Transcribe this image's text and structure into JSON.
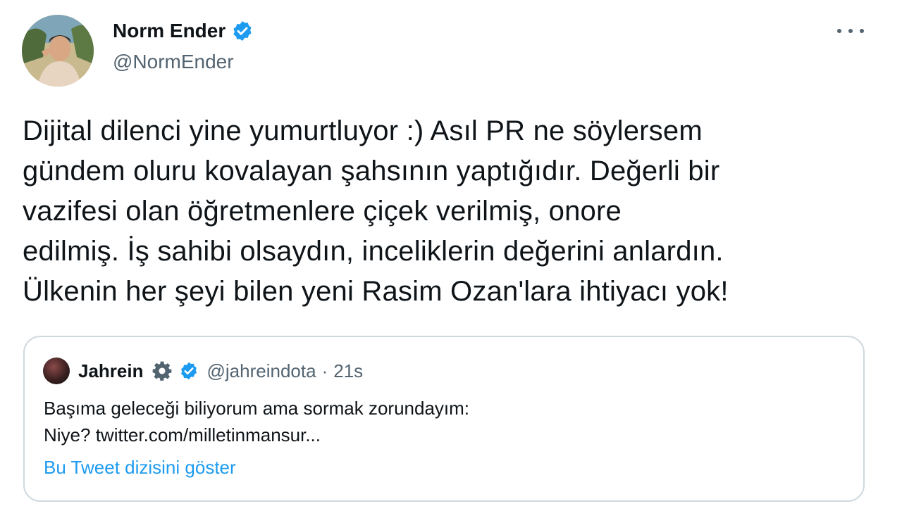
{
  "author": {
    "name": "Norm Ender",
    "handle": "@NormEnder"
  },
  "tweet": {
    "lines": [
      "Dijital dilenci yine yumurtluyor :) Asıl PR ne söylersem",
      "gündem oluru kovalayan şahsının yaptığıdır. Değerli bir",
      "vazifesi olan öğretmenlere çiçek verilmiş, onore",
      "edilmiş. İş sahibi olsaydın, inceliklerin değerini anlardın.",
      "Ülkenin her şeyi bilen yeni Rasim Ozan'lara ihtiyacı yok!"
    ]
  },
  "quote": {
    "name": "Jahrein",
    "handle": "@jahreindota",
    "separator": "·",
    "time": "21s",
    "lines": [
      "Başıma geleceği biliyorum ama sormak zorundayım:",
      "Niye? twitter.com/milletinmansur..."
    ],
    "show_thread": "Bu Tweet dizisini göster"
  },
  "colors": {
    "text_primary": "#0f1419",
    "text_secondary": "#536471",
    "link": "#1d9bf0",
    "verified": "#1d9bf0",
    "border": "#cfd9de"
  },
  "icons": {
    "verified": "verified-badge-icon",
    "more": "more-options-icon",
    "gear": "gear-icon"
  }
}
